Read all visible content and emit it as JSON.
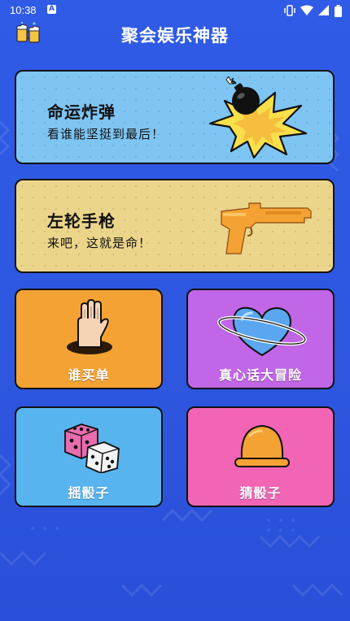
{
  "status_bar": {
    "time": "10:38",
    "notification_icon": "a-notification-icon",
    "icons": [
      "vibrate-icon",
      "wifi-icon",
      "signal-icon",
      "battery-icon"
    ]
  },
  "header": {
    "title": "聚会娱乐神器",
    "logo_icon": "beer-mugs-icon"
  },
  "cards": {
    "bomb": {
      "title": "命运炸弹",
      "subtitle": "看谁能坚挺到最后！",
      "icon": "bomb-icon",
      "color": "#7ec5f4"
    },
    "gun": {
      "title": "左轮手枪",
      "subtitle": "来吧，这就是命！",
      "icon": "gun-icon",
      "color": "#ead58a"
    },
    "pay_bill": {
      "label": "谁买单",
      "icon": "hand-in-hole-icon",
      "color": "#f5a234"
    },
    "truth_or_dare": {
      "label": "真心话大冒险",
      "icon": "heart-planet-icon",
      "color": "#c066e6"
    },
    "shake_dice": {
      "label": "摇骰子",
      "icon": "dice-icon",
      "color": "#58b4ef"
    },
    "guess_dice": {
      "label": "猜骰子",
      "icon": "dice-cup-icon",
      "color": "#f265b4"
    }
  }
}
